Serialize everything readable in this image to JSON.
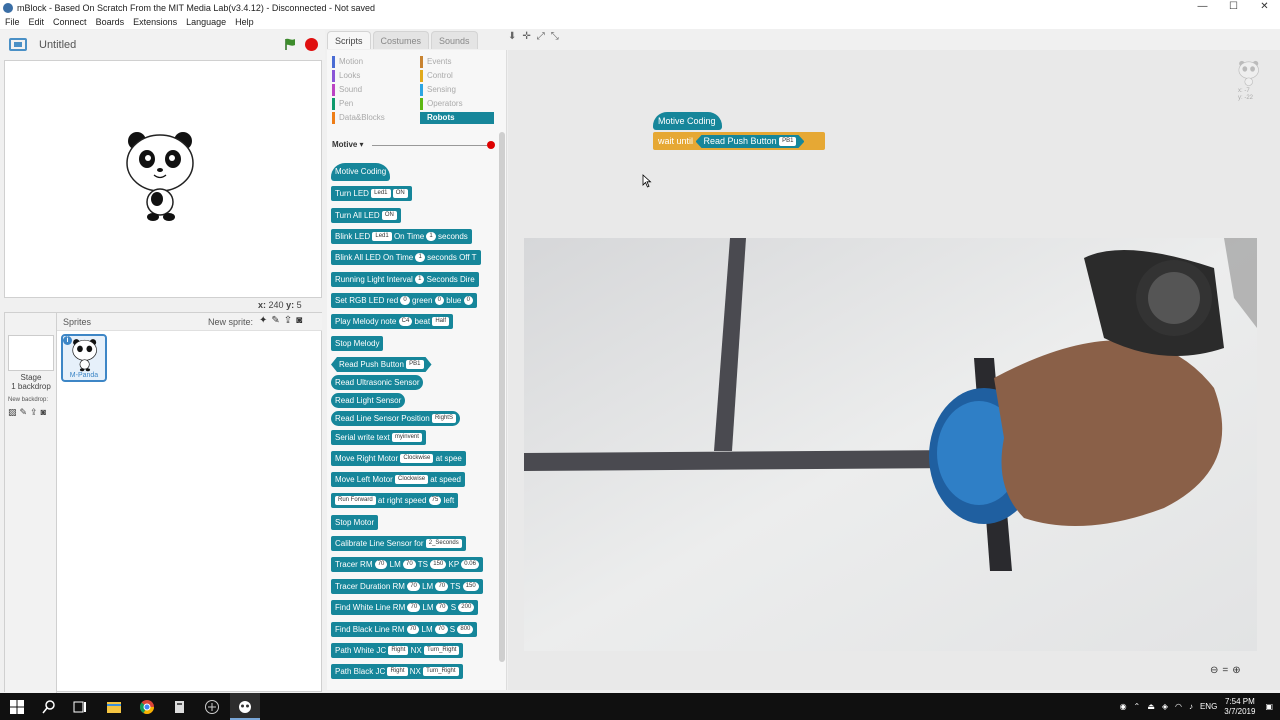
{
  "window": {
    "title": "mBlock - Based On Scratch From the MIT Media Lab(v3.4.12) - Disconnected - Not saved",
    "minimize": "—",
    "maximize": "☐",
    "close": "✕"
  },
  "menu": [
    "File",
    "Edit",
    "Connect",
    "Boards",
    "Extensions",
    "Language",
    "Help"
  ],
  "stage": {
    "project_title": "Untitled",
    "x_label": "x:",
    "x_value": "240",
    "y_label": "y:",
    "y_value": "5"
  },
  "sprites": {
    "header_label": "Sprites",
    "new_sprite_label": "New sprite:",
    "stage_label": "Stage",
    "stage_backdrops": "1 backdrop",
    "new_backdrop_label": "New backdrop:",
    "sprite_name": "M-Panda",
    "info_glyph": "i"
  },
  "palette": {
    "tabs": [
      "Scripts",
      "Costumes",
      "Sounds"
    ],
    "categories": [
      {
        "label": "Motion",
        "color": "#4a6cd4"
      },
      {
        "label": "Looks",
        "color": "#8a55d7"
      },
      {
        "label": "Sound",
        "color": "#bb42c3"
      },
      {
        "label": "Pen",
        "color": "#0e9a6c"
      },
      {
        "label": "Data&Blocks",
        "color": "#ee7d16"
      },
      {
        "label": "Events",
        "color": "#c88330"
      },
      {
        "label": "Control",
        "color": "#e1a91a"
      },
      {
        "label": "Sensing",
        "color": "#2ca5e2"
      },
      {
        "label": "Operators",
        "color": "#5cb712"
      },
      {
        "label": "Robots",
        "color": "#16869a"
      }
    ],
    "extension_name": "Motive ▾"
  },
  "blocks": {
    "motive_coding": "Motive Coding",
    "turn_led": "Turn LED",
    "led1": "Led1",
    "on": "ON",
    "turn_all_led": "Turn All LED",
    "blink_led": "Blink LED",
    "on_time": "On Time",
    "one": "1",
    "seconds": "seconds",
    "blink_all_led": "Blink All LED On Time",
    "seconds_off": "seconds Off T",
    "running_light": "Running Light Interval",
    "seconds_dir": "Seconds Dire",
    "set_rgb": "Set RGB LED red",
    "zero": "0",
    "green": "green",
    "blue": "blue",
    "play_melody": "Play Melody note",
    "c4": "C4",
    "beat": "beat",
    "half": "Half",
    "stop_melody": "Stop Melody",
    "read_push_button": "Read Push Button",
    "pb1": "PB1",
    "read_ultrasonic": "Read Ultrasonic Sensor",
    "read_light": "Read Light Sensor",
    "read_line_pos": "Read Line Sensor Position",
    "right_s": "RightS",
    "serial_write": "Serial write text",
    "myinvent": "myinvent",
    "move_right_motor": "Move Right Motor",
    "clockwise": "Clockwise",
    "at_speed": "at spee",
    "move_left_motor": "Move Left Motor",
    "at_speed2": "at speed",
    "run_forward": "Run Forward",
    "at_right_speed": "at right speed",
    "seventy_five": "75",
    "left": "left",
    "stop_motor": "Stop Motor",
    "calibrate": "Calibrate Line Sensor for",
    "two_seconds": "2_Seconds",
    "tracer": "Tracer RM",
    "seventy": "70",
    "lm": "LM",
    "ts": "TS",
    "one_fifty": "150",
    "kp": "KP",
    "kp_val": "0.06",
    "tracer_duration": "Tracer Duration RM",
    "ts2": "TS",
    "find_white": "Find White Line RM",
    "s": "S",
    "two_hundred": "200",
    "find_black": "Find Black Line RM",
    "eight_hundred": "800",
    "path_white": "Path White JC",
    "right": "Right",
    "nx": "NX",
    "turn_right": "Turn_Right",
    "path_black": "Path Black JC"
  },
  "script": {
    "hat": "Motive Coding",
    "wait_until": "wait until",
    "read_push_button": "Read Push Button",
    "pb1": "PB1",
    "sprite_x": "x: -7",
    "sprite_y": "y: -22"
  },
  "taskbar": {
    "lang": "ENG",
    "time": "7:54 PM",
    "date": "3/7/2019"
  }
}
